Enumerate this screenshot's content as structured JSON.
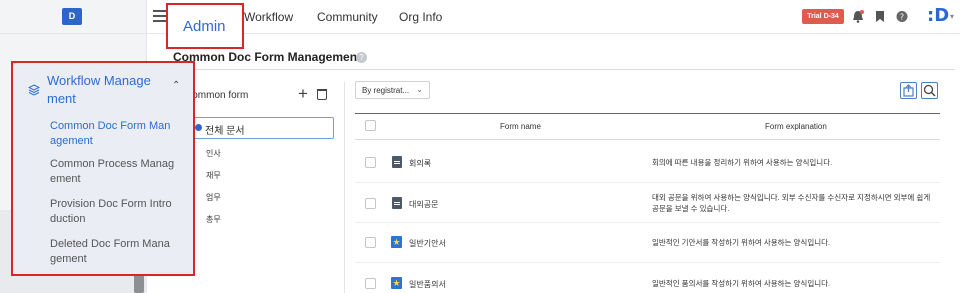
{
  "rail": {
    "logo": "D"
  },
  "topbar": {
    "nav": [
      "Workflow",
      "Community",
      "Org Info"
    ],
    "active_tab": "Admin",
    "trial_badge": "Trial D-34",
    "brand_logo": ":D",
    "icons": [
      "hamburger-icon",
      "bell-icon",
      "bookmark-icon",
      "help-icon"
    ]
  },
  "page": {
    "title": "Common Doc Form Management",
    "help_glyph": "?"
  },
  "tree": {
    "header": "Common form",
    "add_glyph": "+",
    "selected": "전체 문서",
    "children": [
      "인사",
      "재무",
      "업무",
      "총무"
    ]
  },
  "list": {
    "sort_value": "By registrat...",
    "sort_caret": "⌄",
    "columns": {
      "name": "Form name",
      "explanation": "Form explanation"
    },
    "rows": [
      {
        "name": "회의록",
        "icon": "doc-icon",
        "explanation": "회의에 따른 내용을 정리하기 위하여 사용하는 양식입니다."
      },
      {
        "name": "대외공문",
        "icon": "doc-icon",
        "explanation": "대외 공문을 위하여 사용하는 양식입니다. 외부 수신자를 수신자로 지정하시면 외부에 쉽게 공문을 보낼 수 있습니다."
      },
      {
        "name": "일반기안서",
        "icon": "star-doc-icon",
        "explanation": "일반적인 기안서를 작성하기 위하여 사용하는 양식입니다."
      },
      {
        "name": "일반품의서",
        "icon": "star-doc-icon",
        "explanation": "일반적인 품의서를 작성하기 위하여 사용하는 양식입니다."
      }
    ]
  },
  "menu": {
    "title_line1": "Workflow Manage",
    "title_line2": "ment",
    "caret": "⌃",
    "items": [
      {
        "line1": "Common Doc Form Man",
        "line2": "agement",
        "active": true
      },
      {
        "line1": "Common Process Manag",
        "line2": "ement",
        "active": false
      },
      {
        "line1": "Provision Doc Form Intro",
        "line2": "duction",
        "active": false
      },
      {
        "line1": "Deleted Doc Form Mana",
        "line2": "gement",
        "active": false
      }
    ]
  },
  "colors": {
    "accent": "#2b6cd0",
    "highlight_border": "#d6282b",
    "trial": "#e05a4e",
    "menu_bg": "#ebedf5"
  }
}
